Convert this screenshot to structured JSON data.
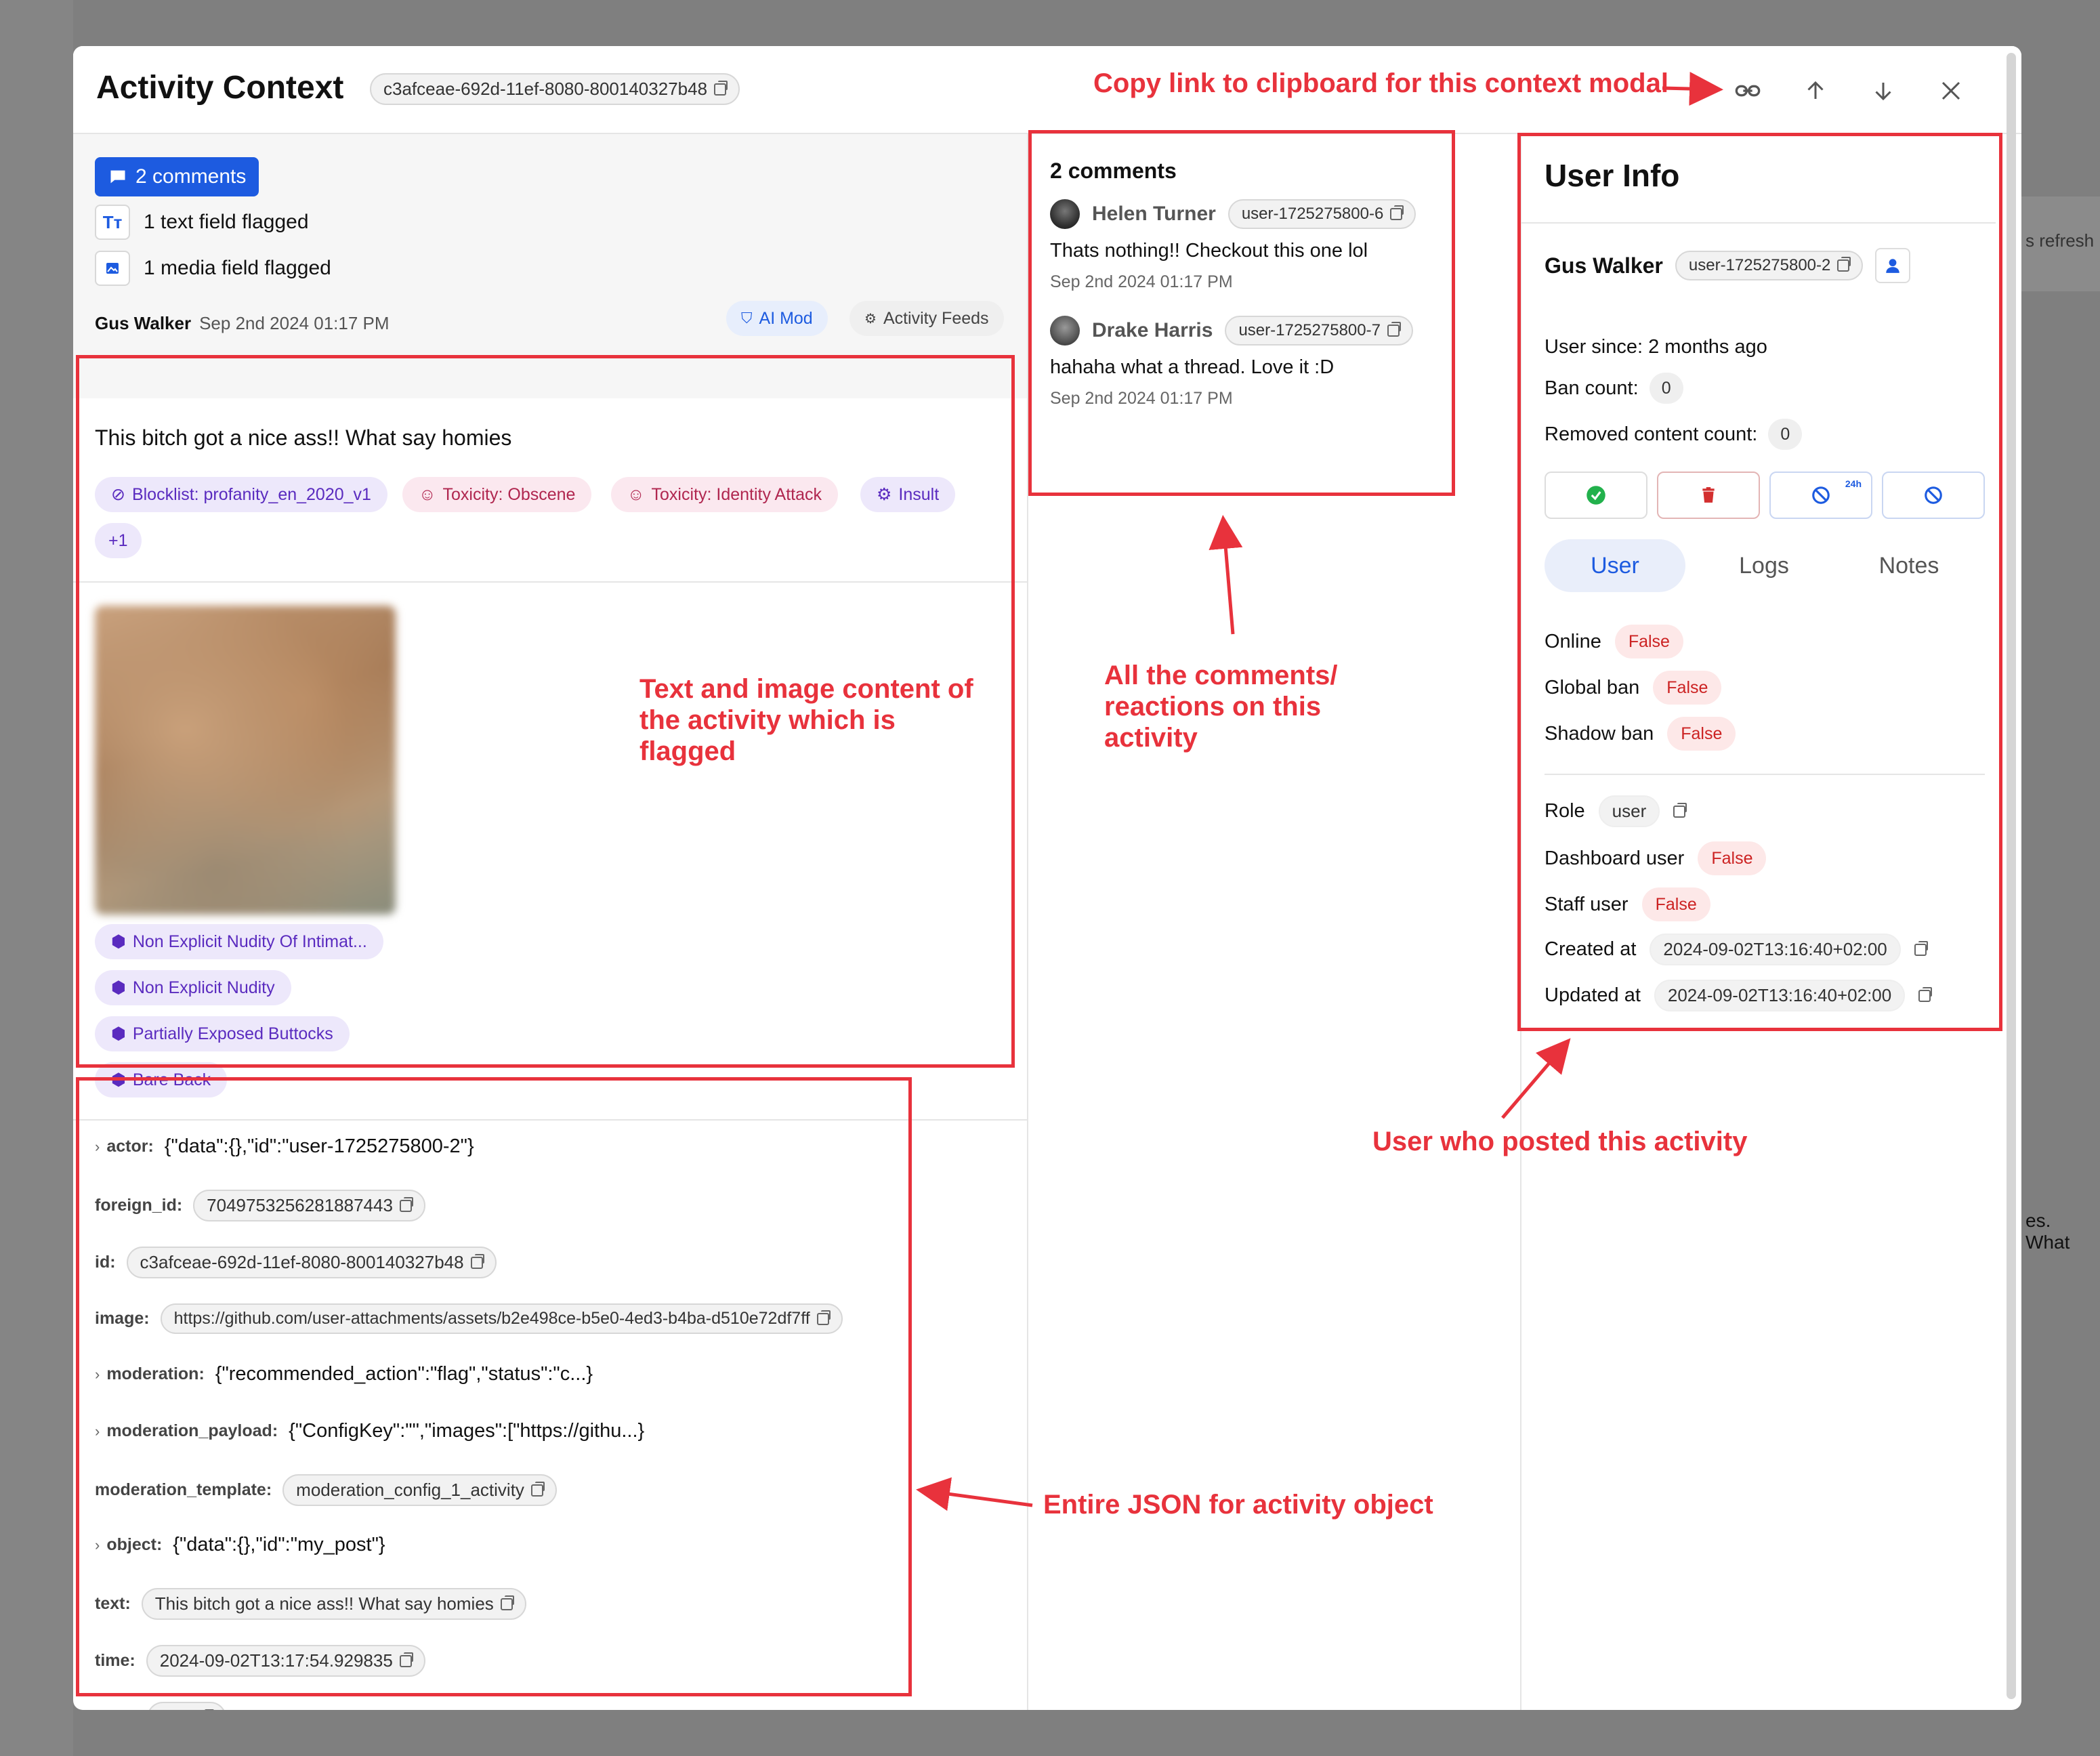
{
  "modal": {
    "title": "Activity Context",
    "activity_id": "c3afceae-692d-11ef-8080-800140327b48"
  },
  "summary": {
    "comments_button": "2 comments",
    "text_flagged": "1 text field flagged",
    "media_flagged": "1 media field flagged",
    "text_icon_label": "Tт",
    "author": "Gus Walker",
    "timestamp": "Sep 2nd 2024 01:17 PM",
    "sources": [
      "AI Mod",
      "Activity Feeds"
    ]
  },
  "flagged_text": {
    "text": "This bitch got a nice ass!! What say homies",
    "labels": [
      "Blocklist: profanity_en_2020_v1",
      "Toxicity: Obscene",
      "Toxicity: Identity Attack",
      "Insult",
      "+1"
    ]
  },
  "flagged_image": {
    "labels": [
      "Non Explicit Nudity Of Intimat...",
      "Non Explicit Nudity",
      "Partially Exposed Buttocks",
      "Bare Back"
    ]
  },
  "json_fields": [
    {
      "key": "actor:",
      "value": "{\"data\":{},\"id\":\"user-1725275800-2\"}",
      "expandable": true,
      "chip": false
    },
    {
      "key": "foreign_id:",
      "value": "7049753256281887443",
      "expandable": false,
      "chip": true
    },
    {
      "key": "id:",
      "value": "c3afceae-692d-11ef-8080-800140327b48",
      "expandable": false,
      "chip": true
    },
    {
      "key": "image:",
      "value": "https://github.com/user-attachments/assets/b2e498ce-b5e0-4ed3-b4ba-d510e72df7ff",
      "expandable": false,
      "chip": true
    },
    {
      "key": "moderation:",
      "value": "{\"recommended_action\":\"flag\",\"status\":\"c...}",
      "expandable": true,
      "chip": false
    },
    {
      "key": "moderation_payload:",
      "value": "{\"ConfigKey\":\"\",\"images\":[\"https://githu...}",
      "expandable": true,
      "chip": false
    },
    {
      "key": "moderation_template:",
      "value": "moderation_config_1_activity",
      "expandable": false,
      "chip": true
    },
    {
      "key": "object:",
      "value": "{\"data\":{},\"id\":\"my_post\"}",
      "expandable": true,
      "chip": false
    },
    {
      "key": "text:",
      "value": "This bitch got a nice ass!! What say homies",
      "expandable": false,
      "chip": true
    },
    {
      "key": "time:",
      "value": "2024-09-02T13:17:54.929835",
      "expandable": false,
      "chip": true
    },
    {
      "key": "verb:",
      "value": "post",
      "expandable": false,
      "chip": true
    }
  ],
  "comments": {
    "title": "2 comments",
    "items": [
      {
        "name": "Helen Turner",
        "user_id": "user-1725275800-6",
        "text": "Thats nothing!! Checkout this one lol",
        "time": "Sep 2nd 2024 01:17 PM"
      },
      {
        "name": "Drake Harris",
        "user_id": "user-1725275800-7",
        "text": "hahaha what a thread. Love it :D",
        "time": "Sep 2nd 2024 01:17 PM"
      }
    ]
  },
  "user_info": {
    "title": "User Info",
    "name": "Gus Walker",
    "user_id": "user-1725275800-2",
    "user_since": "User since: 2 months ago",
    "ban_count_label": "Ban count:",
    "ban_count": "0",
    "removed_label": "Removed content count:",
    "removed_count": "0",
    "ban_24h_badge": "24h",
    "tabs": [
      "User",
      "Logs",
      "Notes"
    ],
    "active_tab": "User",
    "status": [
      {
        "label": "Online",
        "value": "False"
      },
      {
        "label": "Global ban",
        "value": "False"
      },
      {
        "label": "Shadow ban",
        "value": "False"
      }
    ],
    "details": [
      {
        "label": "Role",
        "value": "user",
        "type": "chip"
      },
      {
        "label": "Dashboard user",
        "value": "False",
        "type": "false"
      },
      {
        "label": "Staff user",
        "value": "False",
        "type": "false"
      },
      {
        "label": "Created at",
        "value": "2024-09-02T13:16:40+02:00",
        "type": "chip"
      },
      {
        "label": "Updated at",
        "value": "2024-09-02T13:16:40+02:00",
        "type": "chip"
      }
    ]
  },
  "background": {
    "refresh_text": "s refresh",
    "what_text": "es. What"
  },
  "annotations": {
    "copy_link": "Copy link to clipboard for this context modal",
    "content": "Text and image content of the activity which is flagged",
    "comments": "All the comments/ reactions on this activity",
    "user": "User who posted this activity",
    "json": "Entire JSON for activity object"
  },
  "colors": {
    "accent": "#1d5be0",
    "annotation_red": "#e8323c",
    "false_badge": "#fde8e8"
  }
}
